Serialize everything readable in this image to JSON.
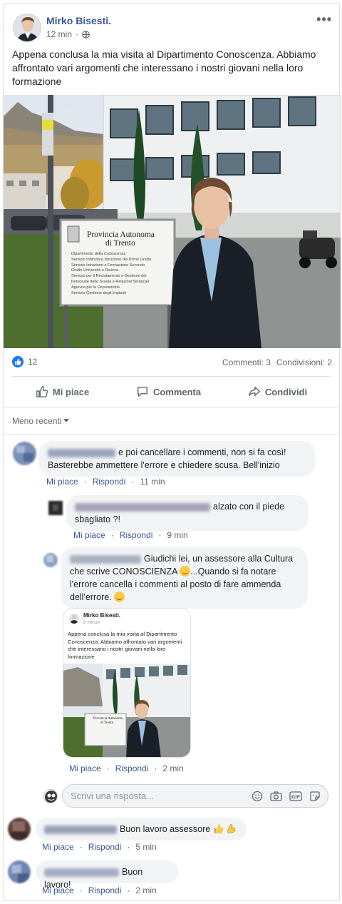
{
  "post": {
    "author": "Mirko Bisesti.",
    "time": "12 min",
    "text": "Appena conclusa la mia visita al Dipartimento Conoscenza. Abbiamo affrontato vari argomenti che interessano i nostri giovani nella loro formazione",
    "sign": {
      "title_line1": "Provincia Autonoma",
      "title_line2": "di Trento",
      "lines": [
        "Dipartimento della Conoscenza",
        "Servizio Infanzia e Istruzione del Primo Grado",
        "Servizio Istruzione e Formazione Secondo",
        "Grado Università e Ricerca",
        "Servizio per il Reclutamento e Gestione del",
        "Personale della Scuola e Relazioni Sindacali",
        "Agenzia per la Depurazione",
        "Servizio Gestione degli Impianti"
      ]
    },
    "likes": "12",
    "comments_count": "Commenti: 3",
    "shares_count": "Condivisioni: 2"
  },
  "actions": {
    "like": "Mi piace",
    "comment": "Commenta",
    "share": "Condividi"
  },
  "sort_label": "Meno recenti",
  "comments": [
    {
      "text": "e poi cancellare i commenti, non si fa così! Basterebbe ammettere l'errore e chiedere scusa. Bell'inizio",
      "like": "Mi piace",
      "reply": "Rispondi",
      "time": "11 min"
    },
    {
      "text_a": "alzato con il piede",
      "text_b": "sbagliato ?!",
      "like": "Mi piace",
      "reply": "Rispondi",
      "time": "9 min"
    },
    {
      "text_a": "Giudichi lei, un assessore alla Cultura",
      "text_b": "che scrive CONOSCIENZA",
      "text_c": "...Quando si fa notare",
      "text_d": "l'errore cancella i commenti al posto di fare ammenda",
      "text_e": "dell'errore.",
      "like": "Mi piace",
      "reply": "Rispondi",
      "time": "2 min"
    },
    {
      "text": "Buon lavoro assessore",
      "like": "Mi piace",
      "reply": "Rispondi",
      "time": "5 min"
    },
    {
      "text": "Buon lavoro!",
      "like": "Mi piace",
      "reply": "Rispondi",
      "time": "2 min"
    }
  ],
  "screenshot_post": {
    "author": "Mirko Bisesti.",
    "time": "8 minuti",
    "text": "Appena conclusa la mia visita al Dipartimento Conoscenza. Abbiamo affrontato vari argomenti che interessano i nostri giovani nella loro formazione",
    "sign_line1": "Provincia Autonoma",
    "sign_line2": "di Trento"
  },
  "reply_box": {
    "placeholder": "Scrivi una risposta..."
  },
  "colors": {
    "link_blue": "#385898",
    "accent_blue": "#1877f2",
    "gray_text": "#606770",
    "bubble_bg": "#f2f3f5"
  },
  "icons": [
    "globe-icon",
    "more-icon",
    "like-icon",
    "comment-icon",
    "share-icon",
    "chevron-down-icon",
    "emoji-icon",
    "camera-icon",
    "gif-icon",
    "sticker-icon",
    "thumbs-up-emoji",
    "flexed-biceps-emoji"
  ]
}
